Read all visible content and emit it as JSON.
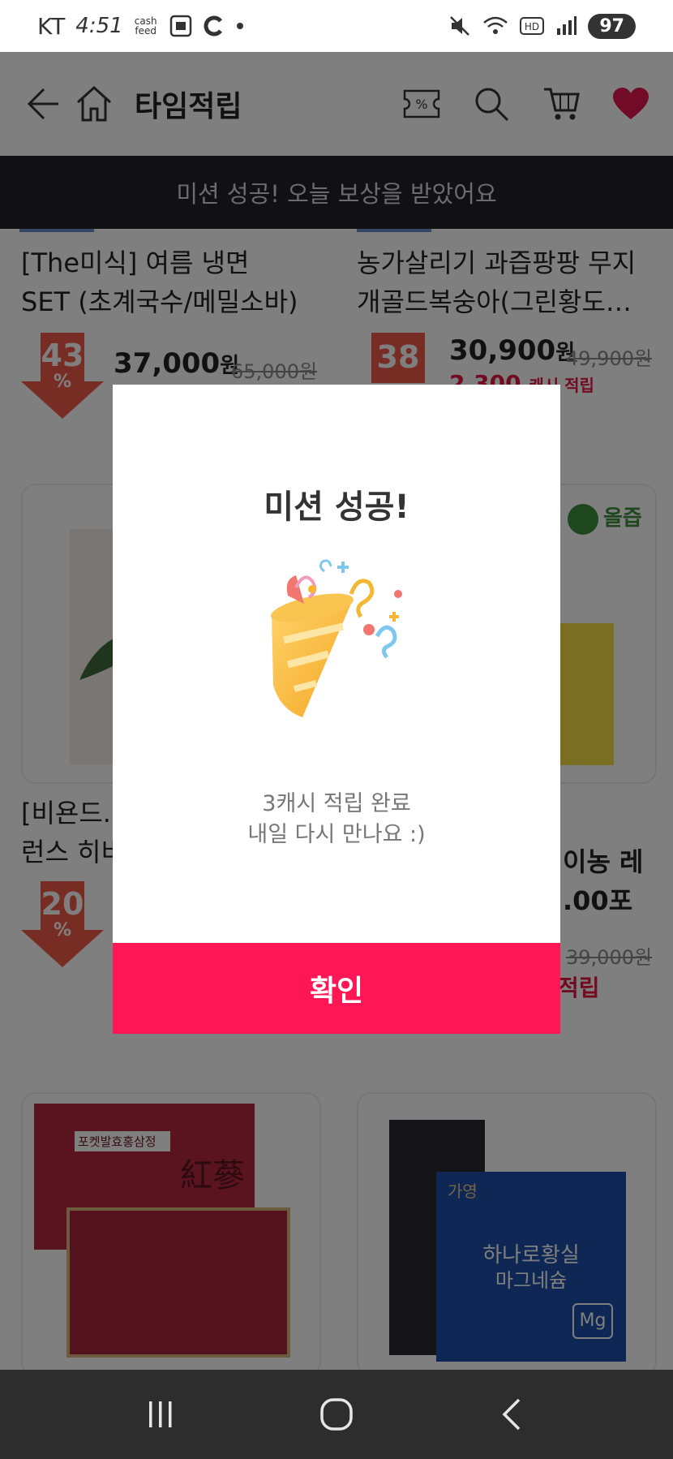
{
  "status_bar": {
    "carrier": "KT",
    "time": "4:51",
    "app_badge": "cash feed",
    "battery": "97"
  },
  "header": {
    "title": "타임적립"
  },
  "toast": {
    "message": "미션 성공! 오늘 보상을 받았어요"
  },
  "products": [
    {
      "title_line1": "[The미식] 여름 냉면",
      "title_line2": "SET (초계국수/메밀소바)",
      "discount": "43",
      "price": "37,000",
      "price_unit": "원",
      "original_price": "65,000원"
    },
    {
      "title_line1": "농가살리기 과즙팡팡 무지",
      "title_line2": "개골드복숭아(그린황도…",
      "discount": "38",
      "price": "30,900",
      "price_unit": "원",
      "original_price": "49,900원",
      "cash": "2,300",
      "cash_label": "캐시 적립"
    },
    {
      "title_line1": "[비욘드.",
      "title_line2": "런스 히비",
      "discount": "20"
    },
    {
      "title_line1": "이농 레",
      "title_line2": ".00포",
      "original_price": "39,000원",
      "cash_label": "적립",
      "brand": "올즙"
    }
  ],
  "discount_symbol": "%",
  "package_texts": {
    "ginseng_name": "포켓발효홍삼정",
    "ginseng_hanja": "紅蔘",
    "magnesium_brand": "가영",
    "magnesium_name_1": "하나로황실",
    "magnesium_name_2": "마그네슘",
    "magnesium_mg": "Mg"
  },
  "modal": {
    "title": "미션 성공!",
    "line1": "3캐시 적립 완료",
    "line2": "내일 다시 만나요 :)",
    "confirm_label": "확인"
  },
  "colors": {
    "accent": "#ff1654",
    "discount": "#f05a49",
    "cash": "#e5173f",
    "heart": "#e5174f",
    "toast_bg": "#222327"
  },
  "icons": {
    "back": "arrow-left-icon",
    "home": "home-icon",
    "coupon": "percent-coupon-icon",
    "search": "search-icon",
    "cart": "cart-icon",
    "wishlist": "heart-icon",
    "nav_recent": "recent-apps-icon",
    "nav_home": "home-circle-icon",
    "nav_back": "chevron-left-icon"
  }
}
